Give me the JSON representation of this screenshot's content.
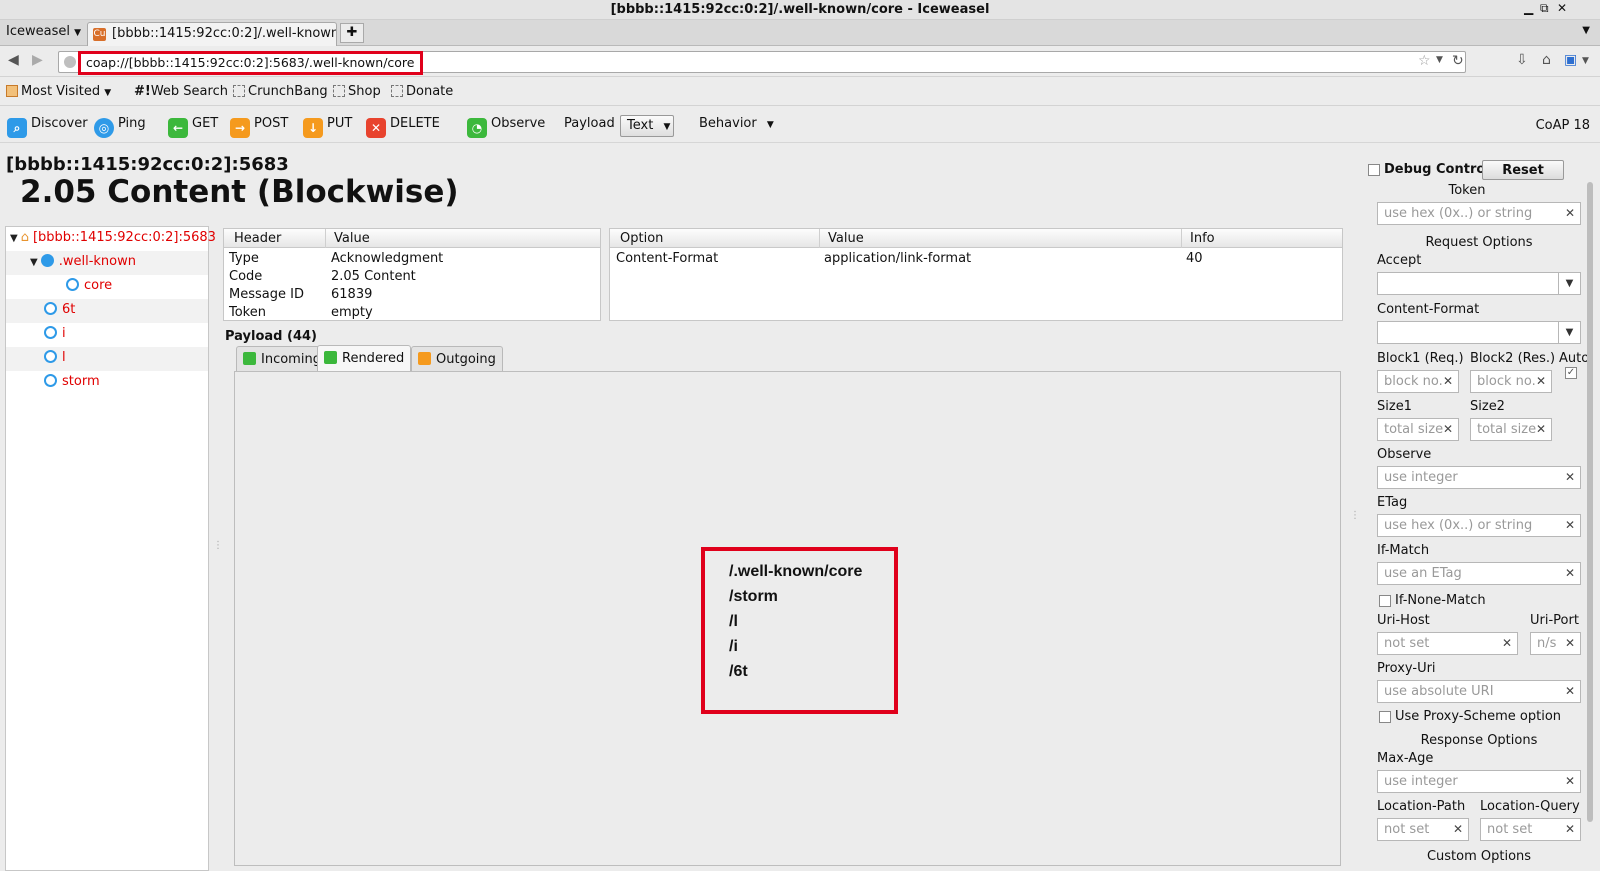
{
  "window": {
    "title": "[bbbb::1415:92cc:0:2]/.well-known/core - Iceweasel",
    "app_menu": "Iceweasel",
    "tab_title": "[bbbb::1415:92cc:0:2]/.well-known/..."
  },
  "navbar": {
    "url": "coap://[bbbb::1415:92cc:0:2]:5683/.well-known/core"
  },
  "bookmarks": {
    "most_visited": "Most Visited",
    "web_search": "Web Search",
    "crunchbang": "CrunchBang",
    "shop": "Shop",
    "donate": "Donate"
  },
  "toolbar": {
    "discover": "Discover",
    "ping": "Ping",
    "get": "GET",
    "post": "POST",
    "put": "PUT",
    "delete": "DELETE",
    "observe": "Observe",
    "payload_label": "Payload",
    "payload_format": "Text",
    "behavior": "Behavior",
    "version": "CoAP 18"
  },
  "response": {
    "host": "[bbbb::1415:92cc:0:2]:5683",
    "status": "2.05 Content (Blockwise)"
  },
  "tree": {
    "root": "[bbbb::1415:92cc:0:2]:5683",
    "well_known": ".well-known",
    "core": "core",
    "n6t": "6t",
    "ni": "i",
    "nl": "l",
    "storm": "storm"
  },
  "headers": {
    "col_header": "Header",
    "col_value": "Value",
    "rows": [
      {
        "header": "Type",
        "value": "Acknowledgment"
      },
      {
        "header": "Code",
        "value": "2.05 Content"
      },
      {
        "header": "Message ID",
        "value": "61839"
      },
      {
        "header": "Token",
        "value": "empty"
      }
    ]
  },
  "options": {
    "col_option": "Option",
    "col_value": "Value",
    "col_info": "Info",
    "rows": [
      {
        "option": "Content-Format",
        "value": "application/link-format",
        "info": "40"
      }
    ]
  },
  "payload": {
    "label": "Payload (44)",
    "tab_incoming": "Incoming",
    "tab_rendered": "Rendered",
    "tab_outgoing": "Outgoing",
    "rendered_lines": [
      "/.well-known/core",
      "/storm",
      "/l",
      "/i",
      "/6t"
    ]
  },
  "sidebar": {
    "debug_control": "Debug Control",
    "reset": "Reset",
    "token_label": "Token",
    "token_placeholder": "use hex (0x..) or string",
    "request_options": "Request Options",
    "accept_label": "Accept",
    "content_format_label": "Content-Format",
    "block1_label": "Block1 (Req.)",
    "block2_label": "Block2 (Res.)",
    "auto_label": "Auto",
    "block_placeholder": "block no.",
    "size1_label": "Size1",
    "size2_label": "Size2",
    "size_placeholder": "total size",
    "observe_label": "Observe",
    "integer_placeholder": "use integer",
    "etag_label": "ETag",
    "etag_placeholder": "use hex (0x..) or string",
    "if_match_label": "If-Match",
    "if_match_placeholder": "use an ETag",
    "if_none_match_label": "If-None-Match",
    "uri_host_label": "Uri-Host",
    "uri_port_label": "Uri-Port",
    "not_set": "not set",
    "port_placeholder": "n/s",
    "proxy_uri_label": "Proxy-Uri",
    "proxy_uri_placeholder": "use absolute URI",
    "use_proxy_scheme": "Use Proxy-Scheme option",
    "response_options": "Response Options",
    "max_age_label": "Max-Age",
    "max_age_placeholder": "use integer",
    "location_path_label": "Location-Path",
    "location_query_label": "Location-Query",
    "custom_options": "Custom Options"
  },
  "colors": {
    "highlight": "#e0001b",
    "link_red": "#e00000",
    "coap_blue": "#2e9ae8",
    "get_green": "#3cb83c",
    "post_orange": "#f59a1e",
    "delete_red": "#e8432e"
  }
}
